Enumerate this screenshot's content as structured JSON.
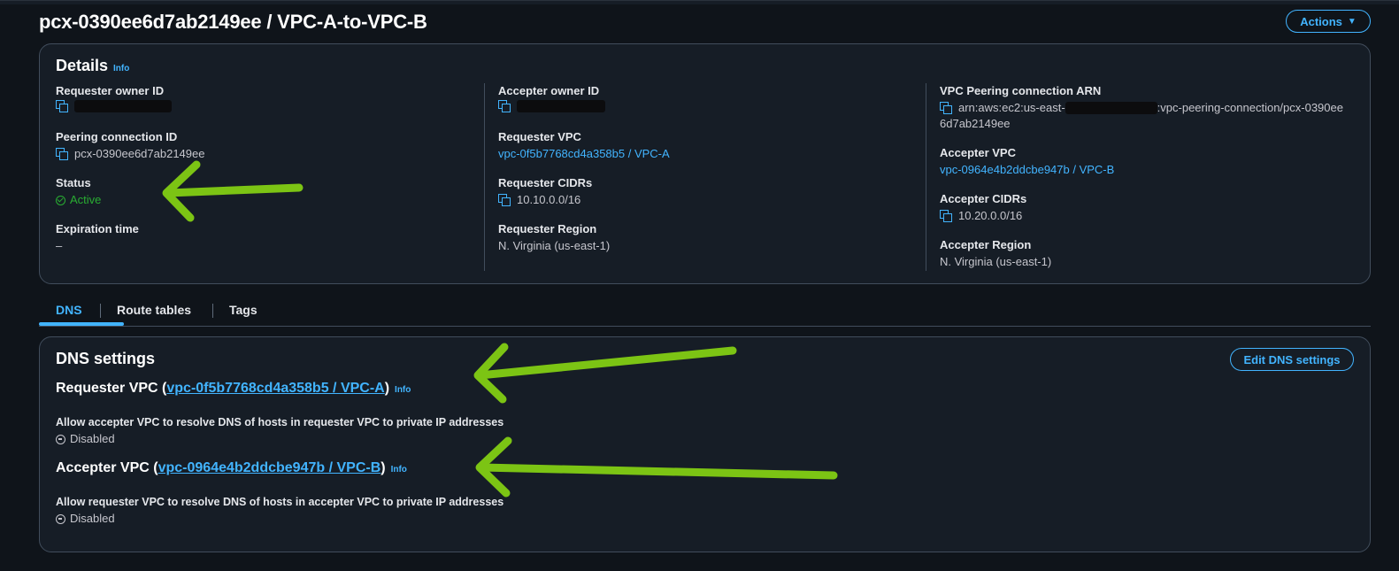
{
  "header": {
    "title": "pcx-0390ee6d7ab2149ee / VPC-A-to-VPC-B",
    "actions_label": "Actions"
  },
  "details": {
    "heading": "Details",
    "info": "Info",
    "requester_owner_id": {
      "label": "Requester owner ID"
    },
    "peering_connection_id": {
      "label": "Peering connection ID",
      "value": "pcx-0390ee6d7ab2149ee"
    },
    "status": {
      "label": "Status",
      "value": "Active"
    },
    "expiration_time": {
      "label": "Expiration time",
      "value": "–"
    },
    "accepter_owner_id": {
      "label": "Accepter owner ID"
    },
    "requester_vpc": {
      "label": "Requester VPC",
      "value": "vpc-0f5b7768cd4a358b5 / VPC-A"
    },
    "requester_cidrs": {
      "label": "Requester CIDRs",
      "value": "10.10.0.0/16"
    },
    "requester_region": {
      "label": "Requester Region",
      "value": "N. Virginia (us-east-1)"
    },
    "arn": {
      "label": "VPC Peering connection ARN",
      "value_prefix": "arn:aws:ec2:us-east-",
      "value_suffix": ":vpc-peering-connection/pcx-0390ee",
      "value_line2": "6d7ab2149ee"
    },
    "accepter_vpc": {
      "label": "Accepter VPC",
      "value": "vpc-0964e4b2ddcbe947b / VPC-B"
    },
    "accepter_cidrs": {
      "label": "Accepter CIDRs",
      "value": "10.20.0.0/16"
    },
    "accepter_region": {
      "label": "Accepter Region",
      "value": "N. Virginia (us-east-1)"
    }
  },
  "tabs": [
    {
      "label": "DNS",
      "active": true
    },
    {
      "label": "Route tables",
      "active": false
    },
    {
      "label": "Tags",
      "active": false
    }
  ],
  "dns": {
    "heading": "DNS settings",
    "edit_label": "Edit DNS settings",
    "info": "Info",
    "requester": {
      "prefix": "Requester VPC (",
      "link": "vpc-0f5b7768cd4a358b5 / VPC-A",
      "suffix": ")",
      "setting_label": "Allow accepter VPC to resolve DNS of hosts in requester VPC to private IP addresses",
      "setting_value": "Disabled"
    },
    "accepter": {
      "prefix": "Accepter VPC (",
      "link": "vpc-0964e4b2ddcbe947b / VPC-B",
      "suffix": ")",
      "setting_label": "Allow requester VPC to resolve DNS of hosts in accepter VPC to private IP addresses",
      "setting_value": "Disabled"
    }
  },
  "colors": {
    "accent": "#42b4ff",
    "success": "#29ad32",
    "annotation_arrow": "#7cc414",
    "background": "#0f141a",
    "panel": "#161d26"
  },
  "icons": [
    "copy-icon",
    "check-circle-icon",
    "disabled-circle-icon",
    "caret-down-icon",
    "arrow-annotation"
  ]
}
